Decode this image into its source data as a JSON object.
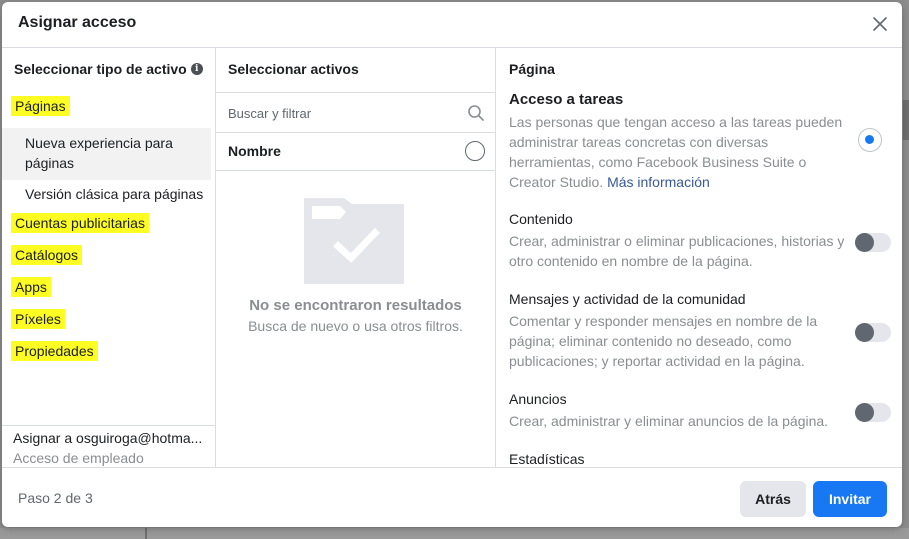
{
  "dialog": {
    "title": "Asignar acceso",
    "close_label": "Cerrar"
  },
  "left_panel": {
    "title": "Seleccionar tipo de activo",
    "items": [
      {
        "label": "Páginas",
        "highlighted": true
      },
      {
        "label": "Cuentas publicitarias",
        "highlighted": true
      },
      {
        "label": "Catálogos",
        "highlighted": true
      },
      {
        "label": "Apps",
        "highlighted": true
      },
      {
        "label": "Píxeles",
        "highlighted": true
      },
      {
        "label": "Propiedades",
        "highlighted": true
      }
    ],
    "sub_items": [
      {
        "label": "Nueva experiencia para páginas",
        "selected": true
      },
      {
        "label": "Versión clásica para páginas",
        "selected": false
      }
    ],
    "footer": {
      "user": "Asignar a osguiroga@hotma...",
      "role": "Acceso de empleado"
    }
  },
  "middle_panel": {
    "title": "Seleccionar activos",
    "search_placeholder": "Buscar y filtrar",
    "column_header": "Nombre",
    "empty_title": "No se encontraron resultados",
    "empty_subtitle": "Busca de nuevo o usa otros filtros."
  },
  "right_panel": {
    "title": "Página",
    "task_access": {
      "title": "Acceso a tareas",
      "description": "Las personas que tengan acceso a las tareas pueden administrar tareas concretas con diversas herramientas, como Facebook Business Suite o Creator Studio.",
      "link": "Más información",
      "selected": true
    },
    "permissions": [
      {
        "title": "Contenido",
        "description": "Crear, administrar o eliminar publicaciones, historias y otro contenido en nombre de la página.",
        "enabled": false
      },
      {
        "title": "Mensajes y actividad de la comunidad",
        "description": "Comentar y responder mensajes en nombre de la página; eliminar contenido no deseado, como publicaciones; y reportar actividad en la página.",
        "enabled": false
      },
      {
        "title": "Anuncios",
        "description": "Crear, administrar y eliminar anuncios de la página.",
        "enabled": false
      },
      {
        "title": "Estadísticas",
        "description": "",
        "enabled": false
      }
    ]
  },
  "footer": {
    "step_text": "Paso 2 de 3",
    "back_label": "Atrás",
    "invite_label": "Invitar"
  },
  "colors": {
    "highlight": "#fdfd24",
    "primary": "#1877f2",
    "link": "#385898",
    "muted_text": "#8a8d91"
  }
}
